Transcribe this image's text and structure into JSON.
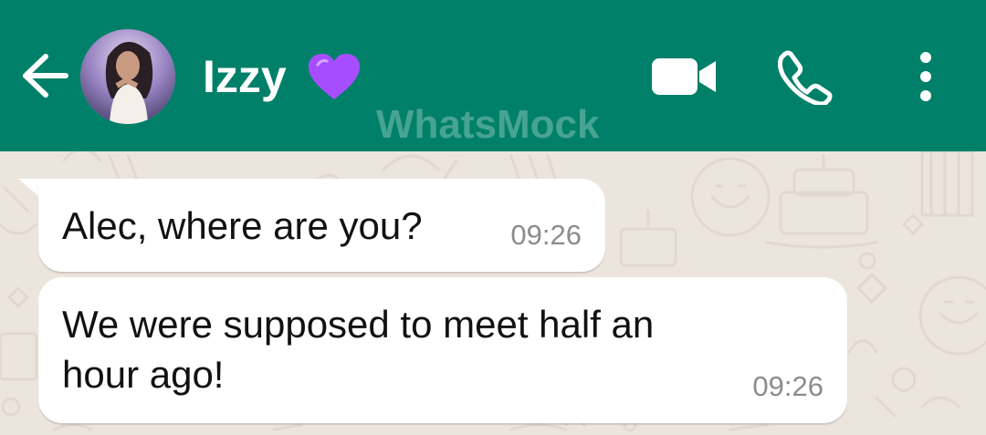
{
  "header": {
    "back_icon": "arrow-left-icon",
    "contact_name": "Izzy",
    "contact_emoji": "purple-heart",
    "watermark": "WhatsMock",
    "actions": [
      {
        "icon": "video-camera-icon"
      },
      {
        "icon": "phone-icon"
      },
      {
        "icon": "more-vert-icon"
      }
    ],
    "color": "#008069"
  },
  "messages": [
    {
      "direction": "incoming",
      "text": "Alec, where are you?",
      "time": "09:26"
    },
    {
      "direction": "incoming",
      "text_lines": [
        "We were supposed to meet half an",
        "hour ago!"
      ],
      "time": "09:26"
    }
  ],
  "theme": {
    "wallpaper": "#ece5dd",
    "bubble": "#ffffff",
    "time_color": "#8c8c8c"
  }
}
